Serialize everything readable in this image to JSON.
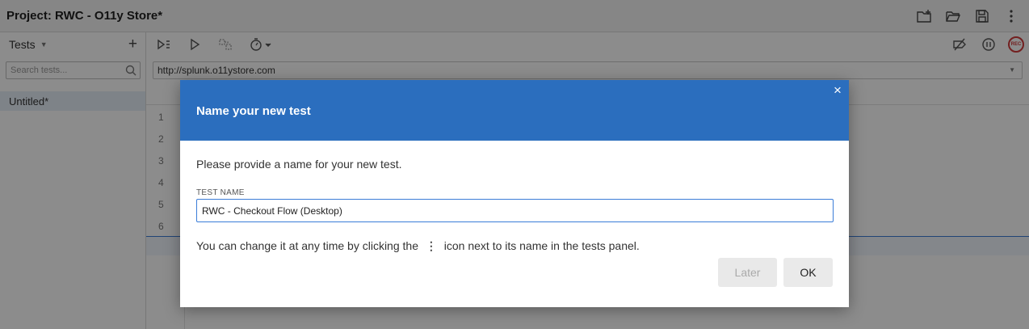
{
  "titlebar": {
    "title": "Project:  RWC - O11y Store*",
    "icons": [
      "new-project-icon",
      "open-project-icon",
      "save-project-icon",
      "more-vert-icon"
    ]
  },
  "sidebar": {
    "tests_label": "Tests",
    "add_label": "+",
    "search_placeholder": "Search tests...",
    "items": [
      {
        "label": "Untitled*"
      }
    ]
  },
  "toolbar": {
    "left_icons": [
      "run-all-icon",
      "run-icon",
      "step-icon",
      "speed-icon"
    ],
    "right_icons": [
      "disable-breakpoints-icon",
      "pause-icon",
      "record-icon"
    ],
    "rec_label": "REC"
  },
  "url": {
    "value": "http://splunk.o11ystore.com"
  },
  "editor": {
    "line_numbers": [
      "1",
      "2",
      "3",
      "4",
      "5",
      "6"
    ]
  },
  "dialog": {
    "title": "Name your new test",
    "close_label": "×",
    "prompt": "Please provide a name for your new test.",
    "field_label": "TEST NAME",
    "field_value": "RWC - Checkout Flow (Desktop)",
    "hint_before": "You can change it at any time by clicking the",
    "hint_icon": "⋮",
    "hint_after": "icon next to its name in the tests panel.",
    "later_label": "Later",
    "ok_label": "OK",
    "header_color": "#2b6ebe"
  }
}
